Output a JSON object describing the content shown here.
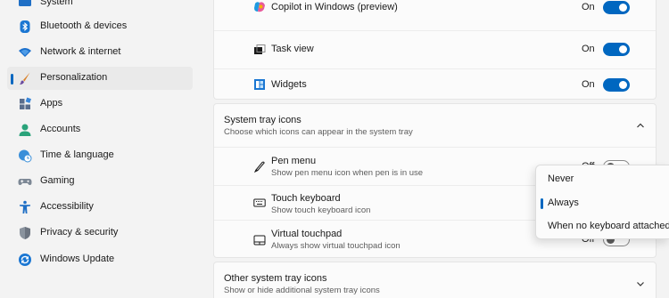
{
  "sidebar": {
    "items": [
      {
        "label": "System",
        "icon": "system-icon"
      },
      {
        "label": "Bluetooth & devices",
        "icon": "bluetooth-icon"
      },
      {
        "label": "Network & internet",
        "icon": "wifi-icon"
      },
      {
        "label": "Personalization",
        "icon": "brush-icon",
        "selected": true
      },
      {
        "label": "Apps",
        "icon": "apps-icon"
      },
      {
        "label": "Accounts",
        "icon": "accounts-icon"
      },
      {
        "label": "Time & language",
        "icon": "globe-clock-icon"
      },
      {
        "label": "Gaming",
        "icon": "gamepad-icon"
      },
      {
        "label": "Accessibility",
        "icon": "accessibility-icon"
      },
      {
        "label": "Privacy & security",
        "icon": "shield-icon"
      },
      {
        "label": "Windows Update",
        "icon": "update-icon"
      }
    ]
  },
  "taskbar_items": {
    "copilot": {
      "label": "Copilot in Windows (preview)",
      "state": "On"
    },
    "task_view": {
      "label": "Task view",
      "state": "On"
    },
    "widgets": {
      "label": "Widgets",
      "state": "On"
    }
  },
  "system_tray": {
    "title": "System tray icons",
    "subtitle": "Choose which icons can appear in the system tray",
    "pen_menu": {
      "label": "Pen menu",
      "sub": "Show pen menu icon when pen is in use",
      "state": "Off"
    },
    "touch_keyboard": {
      "label": "Touch keyboard",
      "sub": "Show touch keyboard icon"
    },
    "virtual_touchpad": {
      "label": "Virtual touchpad",
      "sub": "Always show virtual touchpad icon",
      "state": "Off"
    }
  },
  "other_tray": {
    "title": "Other system tray icons",
    "subtitle": "Show or hide additional system tray icons"
  },
  "dropdown": {
    "options": [
      "Never",
      "Always",
      "When no keyboard attached"
    ],
    "selected": "Always"
  },
  "colors": {
    "accent": "#0067c0",
    "background": "#f3f3f3",
    "card": "#fbfbfb"
  }
}
